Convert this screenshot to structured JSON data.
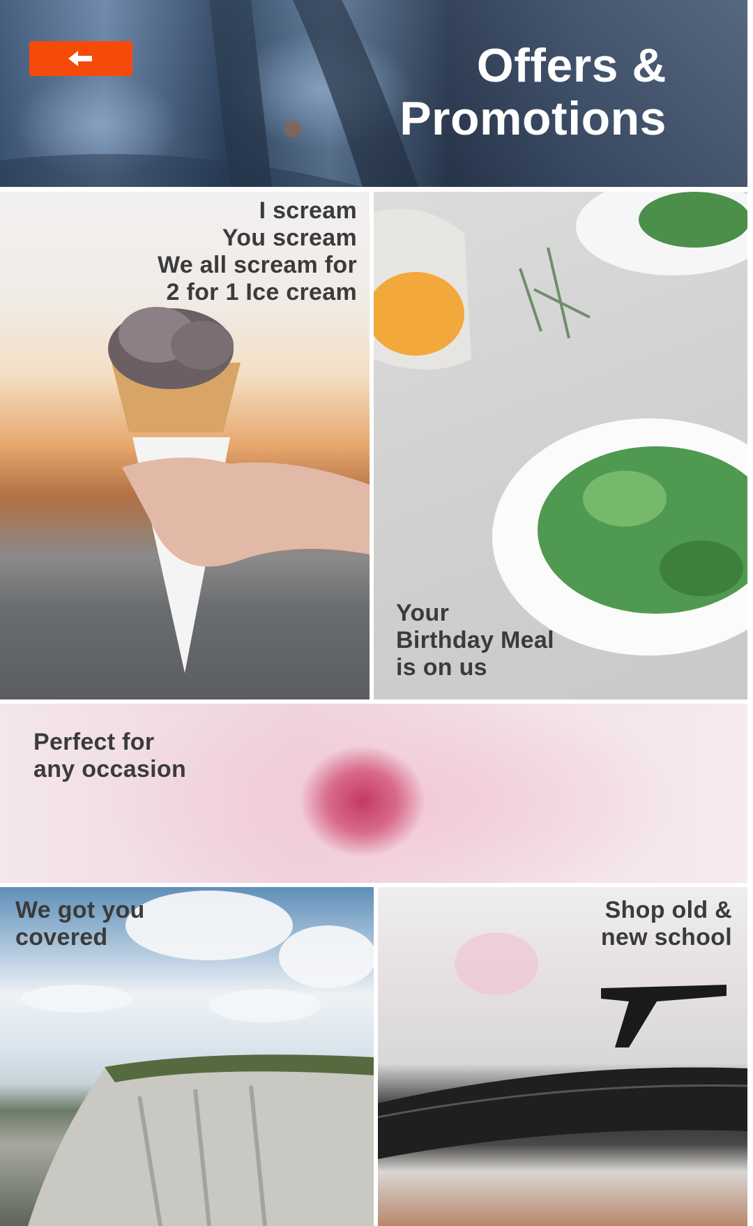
{
  "header": {
    "title_line1": "Offers &",
    "title_line2": "Promotions",
    "back_button_icon": "arrow-left-icon",
    "back_button_color": "#f64a0a"
  },
  "tiles": [
    {
      "id": "ice-cream",
      "lines": [
        "I scream",
        "You scream",
        "We all scream for",
        "2 for 1 Ice cream"
      ]
    },
    {
      "id": "birthday-meal",
      "lines": [
        "Your",
        "Birthday Meal",
        "is on us"
      ]
    },
    {
      "id": "occasion",
      "lines": [
        "Perfect for",
        "any occasion"
      ]
    },
    {
      "id": "covered",
      "lines": [
        "We got you",
        "covered"
      ]
    },
    {
      "id": "shop",
      "lines": [
        "Shop old &",
        "new school"
      ]
    }
  ]
}
